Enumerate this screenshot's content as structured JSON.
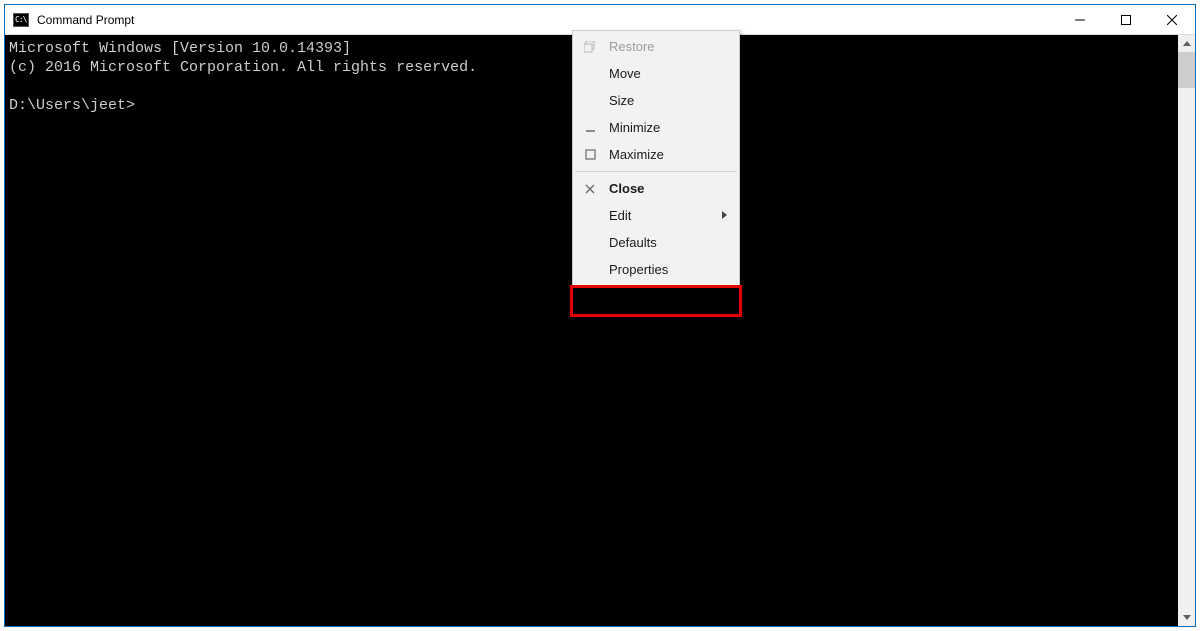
{
  "window": {
    "title": "Command Prompt"
  },
  "console": {
    "line1": "Microsoft Windows [Version 10.0.14393]",
    "line2": "(c) 2016 Microsoft Corporation. All rights reserved.",
    "blank": "",
    "prompt": "D:\\Users\\jeet>"
  },
  "menu": {
    "restore": "Restore",
    "move": "Move",
    "size": "Size",
    "minimize": "Minimize",
    "maximize": "Maximize",
    "close": "Close",
    "edit": "Edit",
    "defaults": "Defaults",
    "properties": "Properties"
  }
}
